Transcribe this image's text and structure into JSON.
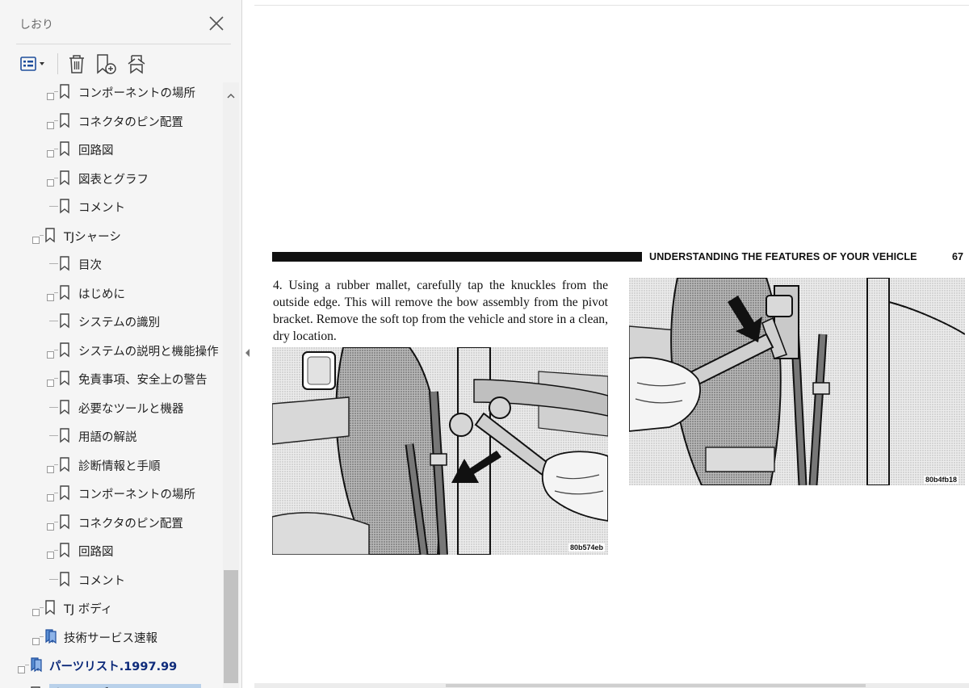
{
  "sidebar": {
    "title": "しおり",
    "close_icon": "close-icon",
    "toolbar": {
      "options_icon": "bookmark-options-icon",
      "delete_icon": "trash-icon",
      "new_bookmark_icon": "new-bookmark-icon",
      "expand_icon": "expand-bookmark-icon"
    },
    "items": [
      {
        "label": "コンポーネントの場所",
        "level": 2,
        "expandable": true
      },
      {
        "label": "コネクタのピン配置",
        "level": 2,
        "expandable": true
      },
      {
        "label": "回路図",
        "level": 2,
        "expandable": true
      },
      {
        "label": "図表とグラフ",
        "level": 2,
        "expandable": true
      },
      {
        "label": "コメント",
        "level": 2,
        "expandable": false
      },
      {
        "label": "TJシャーシ",
        "level": 1,
        "expandable": true
      },
      {
        "label": "目次",
        "level": 2,
        "expandable": false
      },
      {
        "label": "はじめに",
        "level": 2,
        "expandable": true
      },
      {
        "label": "システムの識別",
        "level": 2,
        "expandable": false
      },
      {
        "label": "システムの説明と機能操作",
        "level": 2,
        "expandable": true
      },
      {
        "label": "免責事項、安全上の警告",
        "level": 2,
        "expandable": true
      },
      {
        "label": "必要なツールと機器",
        "level": 2,
        "expandable": false
      },
      {
        "label": "用語の解説",
        "level": 2,
        "expandable": false
      },
      {
        "label": "診断情報と手順",
        "level": 2,
        "expandable": true
      },
      {
        "label": "コンポーネントの場所",
        "level": 2,
        "expandable": true
      },
      {
        "label": "コネクタのピン配置",
        "level": 2,
        "expandable": true
      },
      {
        "label": "回路図",
        "level": 2,
        "expandable": true
      },
      {
        "label": "コメント",
        "level": 2,
        "expandable": false
      },
      {
        "label": "TJ ボディ",
        "level": 1,
        "expandable": true
      },
      {
        "label": "技術サービス速報",
        "level": 1,
        "expandable": true,
        "icon": "bookmark-group-icon"
      },
      {
        "label": "パーツリスト.1997.99",
        "level": 0,
        "expandable": true,
        "icon": "bookmark-group-icon",
        "bold": true
      },
      {
        "label": "オーナーズマニュアル",
        "level": 0,
        "expandable": true,
        "bold": true,
        "selected": true
      }
    ]
  },
  "document": {
    "header_text": "UNDERSTANDING THE FEATURES OF YOUR VEHICLE",
    "page_number": "67",
    "body_text": "4. Using a rubber mallet, carefully tap the knuckles from the outside edge. This will remove the bow assembly from the pivot bracket. Remove the soft top from the vehicle and store in a clean, dry location.",
    "figure1_code": "80b574eb",
    "figure2_code": "80b4fb18"
  },
  "colors": {
    "selection": "#b9d1ea",
    "bold_label": "#0d2a7a",
    "icon_blue": "#1f4e9c"
  }
}
